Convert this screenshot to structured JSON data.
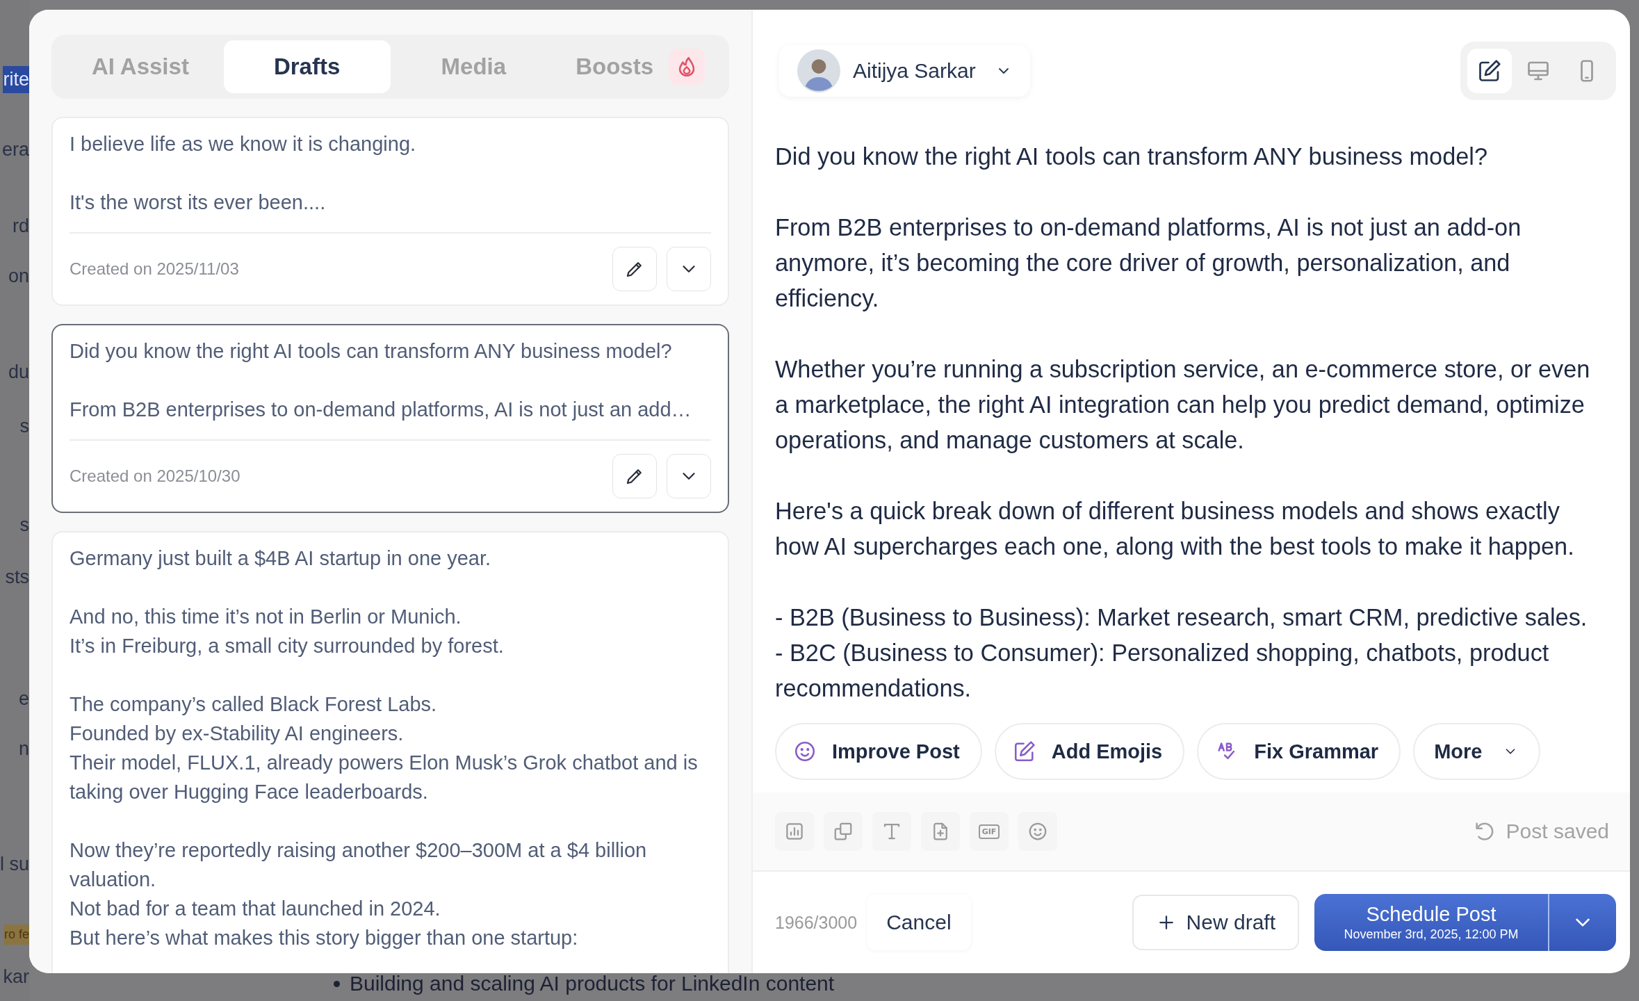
{
  "background": {
    "sidebar_fragments": [
      "rite",
      "era",
      "rd",
      "on",
      "du",
      "s",
      "s",
      "sts",
      "e",
      "n",
      "l su",
      "ro fe",
      "kar"
    ],
    "content_line": "Building and scaling AI products for LinkedIn content"
  },
  "tabs": [
    {
      "label": "AI Assist",
      "selected": false,
      "badge": false
    },
    {
      "label": "Drafts",
      "selected": true,
      "badge": false
    },
    {
      "label": "Media",
      "selected": false,
      "badge": false
    },
    {
      "label": "Boosts",
      "selected": false,
      "badge": true
    }
  ],
  "drafts": [
    {
      "paragraphs": [
        [
          "I believe life as we know it is changing."
        ],
        [
          "It's the worst its ever been...."
        ]
      ],
      "created": "Created on 2025/11/03",
      "selected": false
    },
    {
      "paragraphs": [
        [
          "Did you know the right AI tools can transform ANY business model?"
        ],
        [
          "From B2B enterprises to on-demand platforms, AI is not just an add…"
        ]
      ],
      "created": "Created on 2025/10/30",
      "selected": true
    },
    {
      "paragraphs": [
        [
          "Germany just built a $4B AI startup in one year."
        ],
        [
          "And no, this time it’s not in Berlin or Munich.",
          "It’s in Freiburg, a small city surrounded by forest."
        ],
        [
          "The company’s called Black Forest Labs.",
          "Founded by ex-Stability AI engineers.",
          "Their model, FLUX.1, already powers Elon Musk’s Grok chatbot and is taking over Hugging Face leaderboards."
        ],
        [
          "Now they’re reportedly raising another $200–300M at a $4 billion valuation.",
          "Not bad for a team that launched in 2024.",
          "But here’s what makes this story bigger than one startup:"
        ]
      ],
      "selected": false
    }
  ],
  "author": {
    "name": "Aitijya Sarkar"
  },
  "view_modes": [
    {
      "kind": "edit",
      "selected": true
    },
    {
      "kind": "desktop",
      "selected": false
    },
    {
      "kind": "mobile",
      "selected": false
    }
  ],
  "post": {
    "paragraphs": [
      [
        "Did you know the right AI tools can transform ANY business model?"
      ],
      [
        "From B2B enterprises to on-demand platforms, AI is not just an add-on anymore, it’s becoming the core driver of growth, personalization, and efficiency."
      ],
      [
        "Whether you’re running a subscription service, an e-commerce store, or even a marketplace, the right AI integration can help you predict demand, optimize operations, and manage customers at scale."
      ],
      [
        "Here's a quick break down of different business models and shows exactly how AI supercharges each one, along with the best tools to make it happen."
      ],
      [
        "- B2B (Business to Business): Market research, smart CRM, predictive sales.",
        "- B2C (Business to Consumer): Personalized shopping, chatbots, product recommendations."
      ]
    ]
  },
  "actions": [
    {
      "kind": "improve",
      "label": "Improve Post"
    },
    {
      "kind": "emojis",
      "label": "Add Emojis"
    },
    {
      "kind": "grammar",
      "label": "Fix Grammar"
    },
    {
      "kind": "dropdown",
      "label": "More"
    }
  ],
  "toolbar": [
    {
      "kind": "chart"
    },
    {
      "kind": "copy"
    },
    {
      "kind": "text"
    },
    {
      "kind": "file"
    },
    {
      "kind": "gif",
      "label": "GIF"
    },
    {
      "kind": "emoji"
    }
  ],
  "status": "Post saved",
  "footer": {
    "count": "1966/3000",
    "cancel": "Cancel",
    "new_draft": "New draft",
    "schedule": {
      "label": "Schedule Post",
      "date": "November 3rd, 2025, 12:00 PM"
    }
  }
}
